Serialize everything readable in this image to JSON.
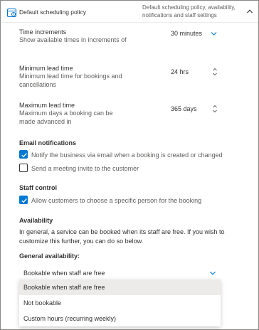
{
  "header": {
    "title": "Default scheduling policy",
    "description": "Default scheduling policy, availability, notifications and staff settings",
    "calendar_icon": "calendar-icon",
    "collapse_icon": "chevron-up-icon"
  },
  "time_increments": {
    "label": "Time increments",
    "help": "Show available times in increments of",
    "value": "30 minutes"
  },
  "min_lead": {
    "label": "Minimum lead time",
    "help": "Minimum lead time for bookings and cancellations",
    "value": "24 hrs"
  },
  "max_lead": {
    "label": "Maximum lead time",
    "help": "Maximum days a booking can be made advanced in",
    "value": "365 days"
  },
  "email": {
    "heading": "Email notifications",
    "notify_label": "Notify the business via email when a booking is created or changed",
    "notify_checked": true,
    "invite_label": "Send a meeting invite to the customer",
    "invite_checked": false
  },
  "staff": {
    "heading": "Staff control",
    "allow_label": "Allow customers to choose a specific person for the booking",
    "allow_checked": true
  },
  "availability": {
    "heading": "Availability",
    "text": "In general, a service can be booked when its staff are free. If you wish to customize this further, you can do so below.",
    "general_label": "General availability:",
    "selected": "Bookable when staff are free",
    "options": [
      "Bookable when staff are free",
      "Not bookable",
      "Custom hours (recurring weekly)"
    ]
  },
  "colors": {
    "accent": "#0078d4",
    "text": "#323130",
    "muted": "#605e5c"
  }
}
